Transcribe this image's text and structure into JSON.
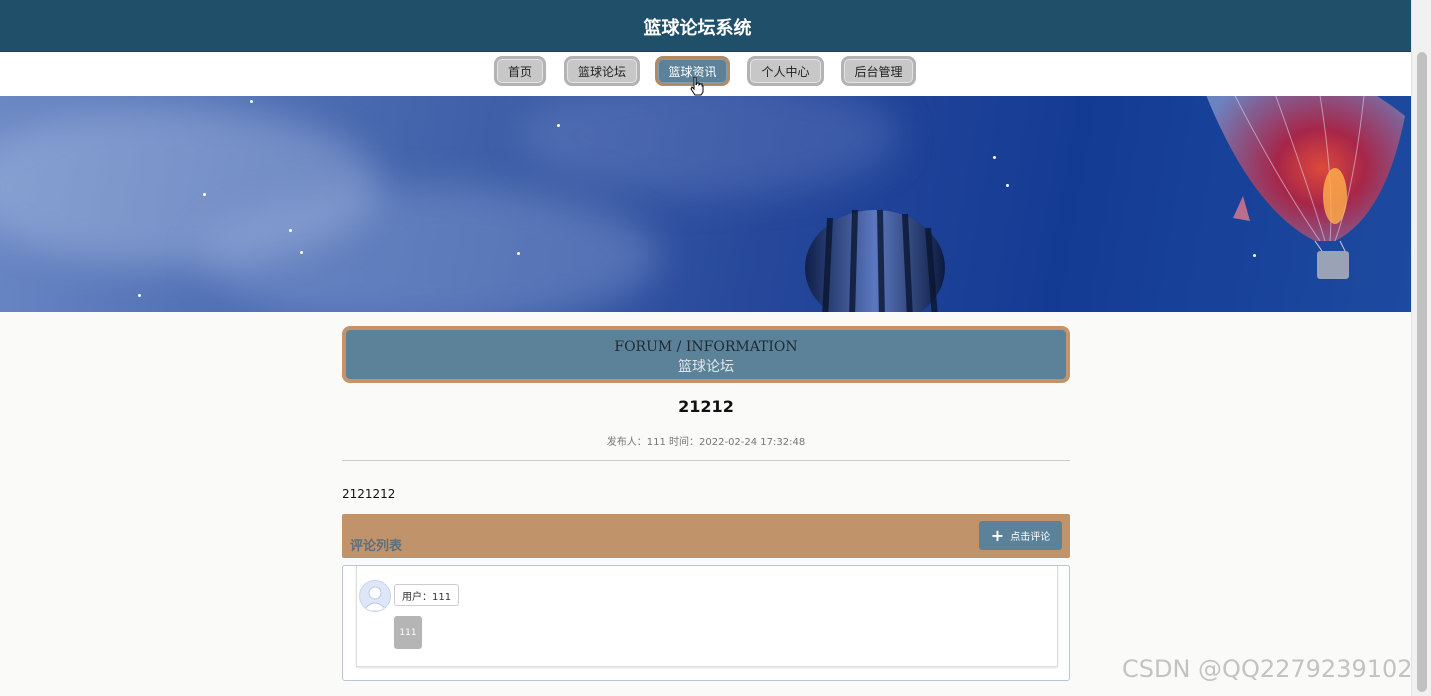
{
  "header": {
    "title": "篮球论坛系统"
  },
  "nav": {
    "items": [
      {
        "label": "首页"
      },
      {
        "label": "篮球论坛"
      },
      {
        "label": "篮球资讯"
      },
      {
        "label": "个人中心"
      },
      {
        "label": "后台管理"
      }
    ],
    "active_index": 2
  },
  "section": {
    "title_en": "FORUM / INFORMATION",
    "title_cn": "篮球论坛"
  },
  "post": {
    "title": "21212",
    "meta": "发布人：111 时间：2022-02-24 17:32:48",
    "body": "2121212"
  },
  "comments": {
    "header": "评论列表",
    "add_button": "点击评论",
    "items": [
      {
        "user": "用户：111",
        "content": "111"
      }
    ]
  },
  "watermark": "CSDN @QQ2279239102",
  "colors": {
    "topbar": "#204f69",
    "accent": "#5c8299",
    "border_accent": "#c4936a",
    "comment_bar": "#c0936b"
  },
  "icons": {
    "add": "plus-icon",
    "avatar": "user-avatar-icon",
    "cursor": "hand-pointer-icon"
  }
}
